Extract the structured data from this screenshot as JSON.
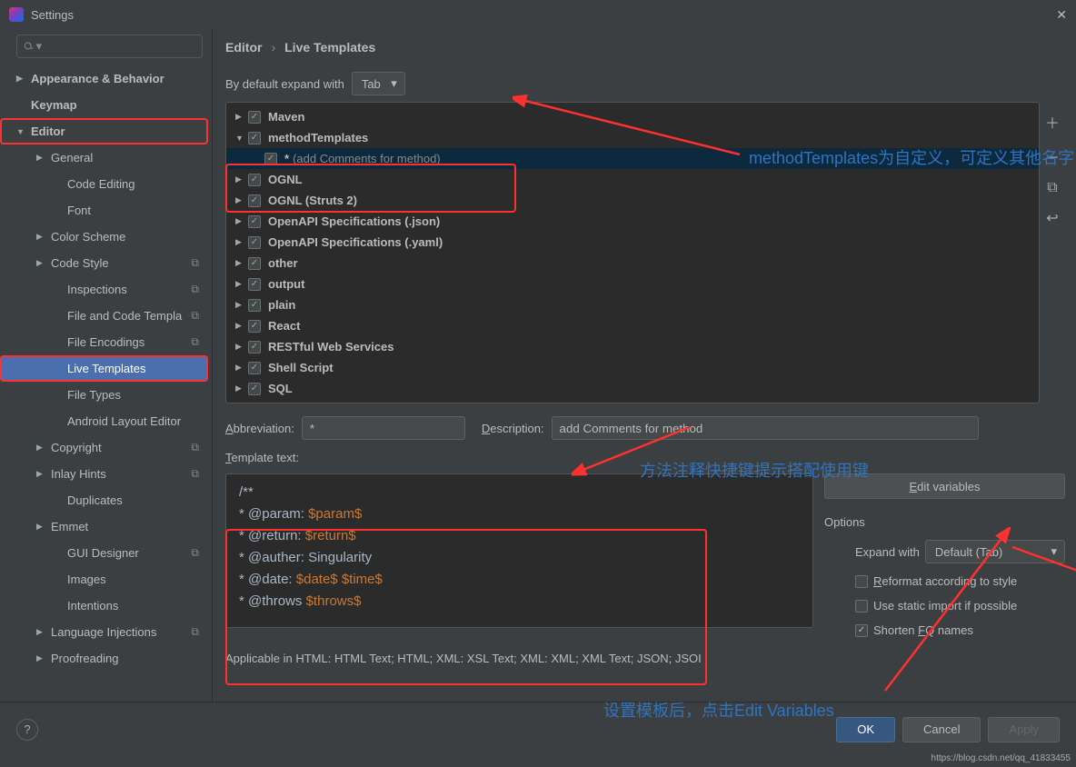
{
  "window": {
    "title": "Settings"
  },
  "breadcrumb": {
    "a": "Editor",
    "b": "Live Templates"
  },
  "expandRow": {
    "label": "By default expand with",
    "value": "Tab"
  },
  "sidebar": {
    "items": [
      {
        "label": "Appearance & Behavior",
        "depth": 0,
        "arrow": "▶",
        "bold": true
      },
      {
        "label": "Keymap",
        "depth": 0,
        "arrow": "",
        "bold": true
      },
      {
        "label": "Editor",
        "depth": 0,
        "arrow": "▼",
        "bold": true,
        "red": true
      },
      {
        "label": "General",
        "depth": 1,
        "arrow": "▶"
      },
      {
        "label": "Code Editing",
        "depth": 2,
        "arrow": ""
      },
      {
        "label": "Font",
        "depth": 2,
        "arrow": ""
      },
      {
        "label": "Color Scheme",
        "depth": 1,
        "arrow": "▶"
      },
      {
        "label": "Code Style",
        "depth": 1,
        "arrow": "▶",
        "meta": "⧉"
      },
      {
        "label": "Inspections",
        "depth": 2,
        "arrow": "",
        "meta": "⧉"
      },
      {
        "label": "File and Code Templa",
        "depth": 2,
        "arrow": "",
        "meta": "⧉"
      },
      {
        "label": "File Encodings",
        "depth": 2,
        "arrow": "",
        "meta": "⧉"
      },
      {
        "label": "Live Templates",
        "depth": 2,
        "arrow": "",
        "sel": true,
        "red": true
      },
      {
        "label": "File Types",
        "depth": 2,
        "arrow": ""
      },
      {
        "label": "Android Layout Editor",
        "depth": 2,
        "arrow": ""
      },
      {
        "label": "Copyright",
        "depth": 1,
        "arrow": "▶",
        "meta": "⧉"
      },
      {
        "label": "Inlay Hints",
        "depth": 1,
        "arrow": "▶",
        "meta": "⧉"
      },
      {
        "label": "Duplicates",
        "depth": 2,
        "arrow": ""
      },
      {
        "label": "Emmet",
        "depth": 1,
        "arrow": "▶"
      },
      {
        "label": "GUI Designer",
        "depth": 2,
        "arrow": "",
        "meta": "⧉"
      },
      {
        "label": "Images",
        "depth": 2,
        "arrow": ""
      },
      {
        "label": "Intentions",
        "depth": 2,
        "arrow": ""
      },
      {
        "label": "Language Injections",
        "depth": 1,
        "arrow": "▶",
        "meta": "⧉"
      },
      {
        "label": "Proofreading",
        "depth": 1,
        "arrow": "▶"
      }
    ]
  },
  "templateList": [
    {
      "arrow": "▶",
      "name": "Maven"
    },
    {
      "arrow": "▼",
      "name": "methodTemplates",
      "red": true
    },
    {
      "arrow": "",
      "name": "*",
      "desc": " (add Comments for method)",
      "child": true,
      "sel": true
    },
    {
      "arrow": "▶",
      "name": "OGNL"
    },
    {
      "arrow": "▶",
      "name": "OGNL (Struts 2)"
    },
    {
      "arrow": "▶",
      "name": "OpenAPI Specifications (.json)"
    },
    {
      "arrow": "▶",
      "name": "OpenAPI Specifications (.yaml)"
    },
    {
      "arrow": "▶",
      "name": "other"
    },
    {
      "arrow": "▶",
      "name": "output"
    },
    {
      "arrow": "▶",
      "name": "plain"
    },
    {
      "arrow": "▶",
      "name": "React"
    },
    {
      "arrow": "▶",
      "name": "RESTful Web Services"
    },
    {
      "arrow": "▶",
      "name": "Shell Script"
    },
    {
      "arrow": "▶",
      "name": "SQL"
    }
  ],
  "annotations": {
    "a1": "methodTemplates为自定义，可定义其他名字",
    "a2": "方法注释快捷键提示搭配使用键",
    "a3": "设置模板后，点击Edit Variables"
  },
  "form": {
    "abbrevLabel": "Abbreviation:",
    "abbrevValue": "*",
    "descLabel": "Description:",
    "descValue": "add Comments for method",
    "templateTextLabel": "Template text:",
    "editVariables": "Edit variables",
    "optionsTitle": "Options",
    "expandWithLabel": "Expand with",
    "expandWithValue": "Default (Tab)",
    "opt1": "Reformat according to style",
    "opt2": "Use static import if possible",
    "opt3": "Shorten FQ names",
    "applicable": "Applicable in HTML: HTML Text; HTML; XML: XSL Text; XML: XML; XML Text; JSON; JSOI"
  },
  "code": {
    "l1": "/**",
    "l2a": " * @param: ",
    "l2b": "$param$",
    "l3a": " * @return: ",
    "l3b": "$return$",
    "l4": " * @auther: Singularity",
    "l5a": " * @date: ",
    "l5b": "$date$",
    "l5c": " ",
    "l5d": "$time$",
    "l6a": " * @throws ",
    "l6b": "$throws$"
  },
  "footer": {
    "ok": "OK",
    "cancel": "Cancel",
    "apply": "Apply"
  },
  "watermark": "https://blog.csdn.net/qq_41833455"
}
